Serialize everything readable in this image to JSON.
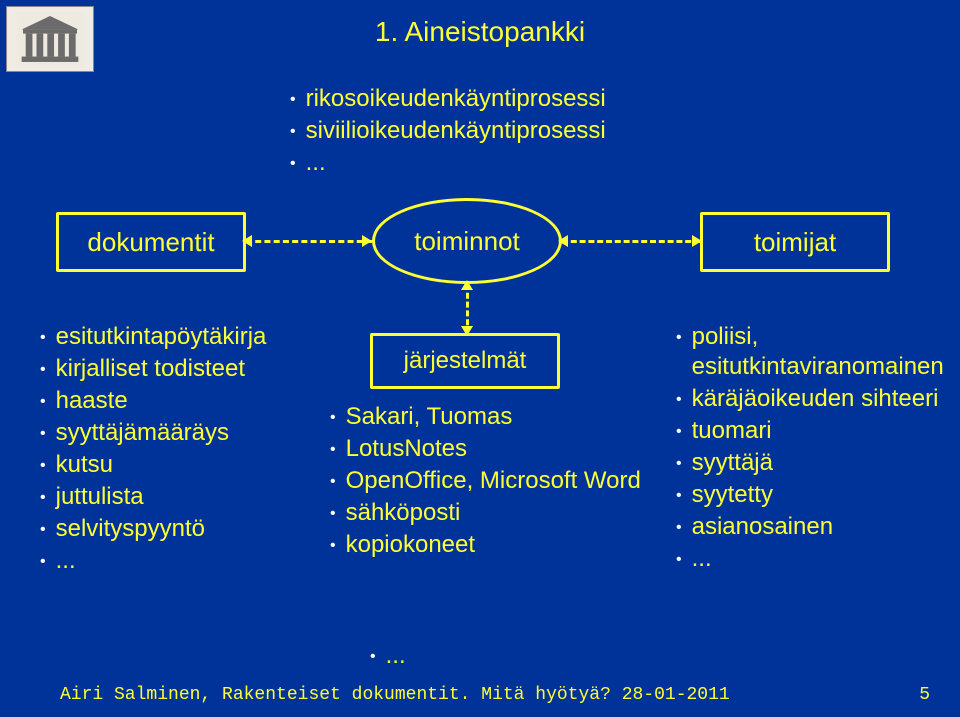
{
  "title": "1. Aineistopankki",
  "top_bullets": [
    "rikosoikeudenkäyntiprosessi",
    "siviilioikeudenkäyntiprosessi",
    "..."
  ],
  "nodes": {
    "dokumentit": "dokumentit",
    "toiminnot": "toiminnot",
    "toimijat": "toimijat",
    "jarjestelmat": "järjestelmät"
  },
  "left_bullets": [
    "esitutkintapöytäkirja",
    "kirjalliset todisteet",
    "haaste",
    "syyttäjämääräys",
    "kutsu",
    "juttulista",
    "selvityspyyntö",
    "..."
  ],
  "mid_bullets": [
    "Sakari, Tuomas",
    "LotusNotes",
    "OpenOffice, Microsoft Word",
    "sähköposti",
    "kopiokoneet"
  ],
  "mid_extra": "...",
  "right_bullets": [
    "poliisi, esitutkintaviranomainen",
    "käräjäoikeuden sihteeri",
    "tuomari",
    "syyttäjä",
    "syytetty",
    "asianosainen",
    "..."
  ],
  "footer": {
    "left": "Airi Salminen, Rakenteiset dokumentit. Mitä hyötyä? 28-01-2011",
    "right": "5"
  }
}
